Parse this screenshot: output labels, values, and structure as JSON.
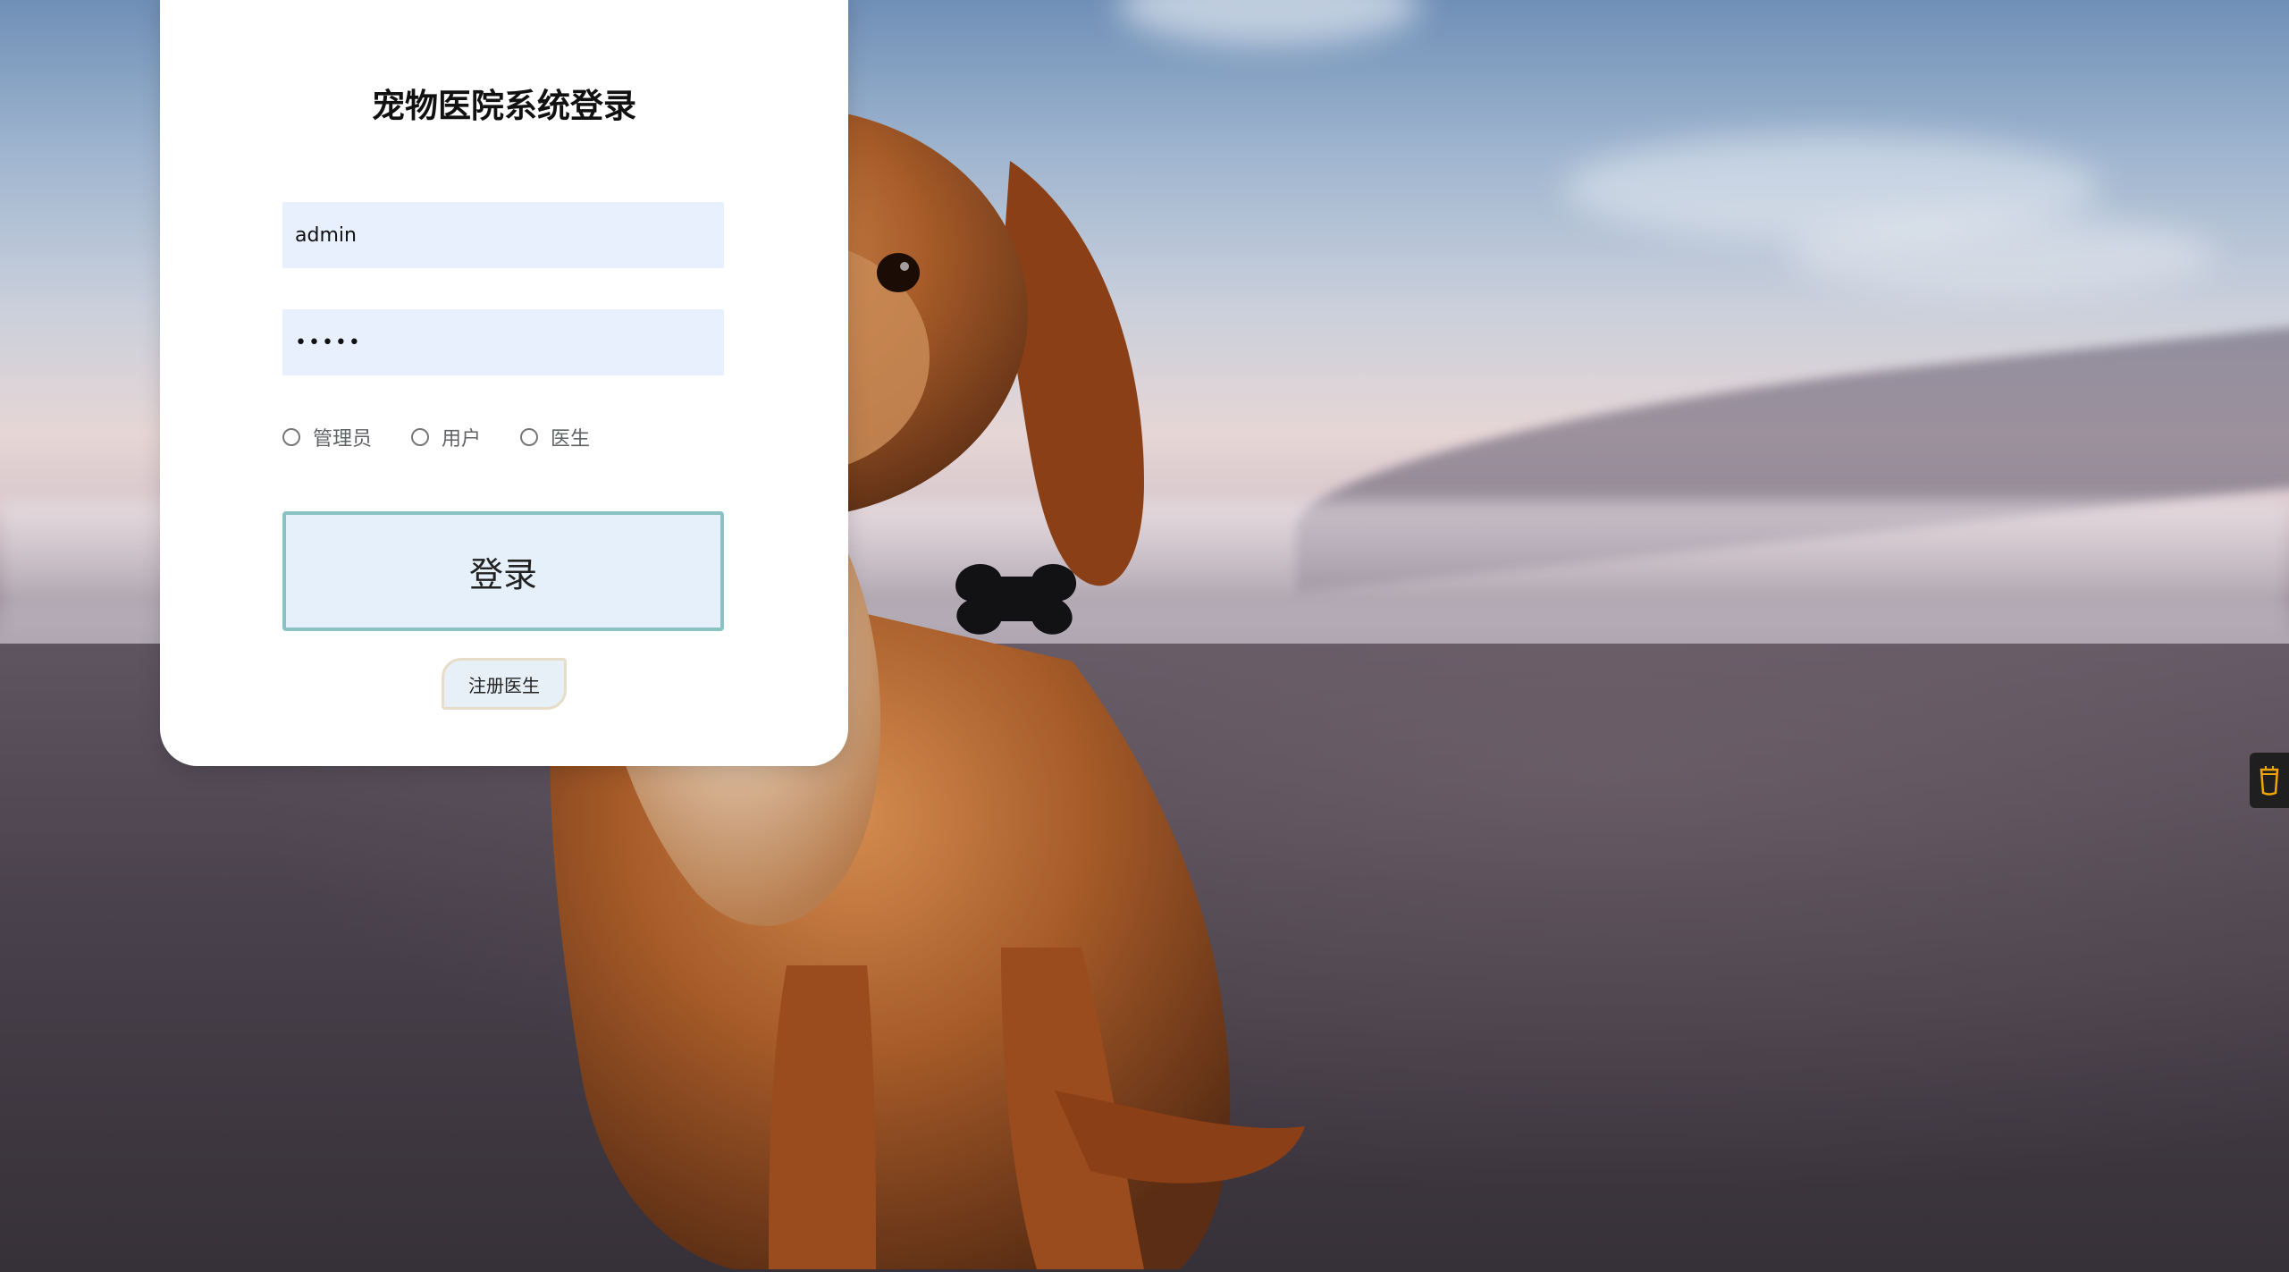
{
  "login": {
    "title": "宠物医院系统登录",
    "username_value": "admin",
    "password_value": "•••••",
    "roles": [
      {
        "label": "管理员"
      },
      {
        "label": "用户"
      },
      {
        "label": "医生"
      }
    ],
    "login_button_label": "登录",
    "register_button_label": "注册医生"
  },
  "colors": {
    "input_background": "#e8f0fe",
    "login_button_background": "#e6f0fb",
    "login_button_border": "#88c3c2",
    "card_background": "#ffffff"
  },
  "icons": {
    "side_widget": "glass-cup-icon"
  }
}
